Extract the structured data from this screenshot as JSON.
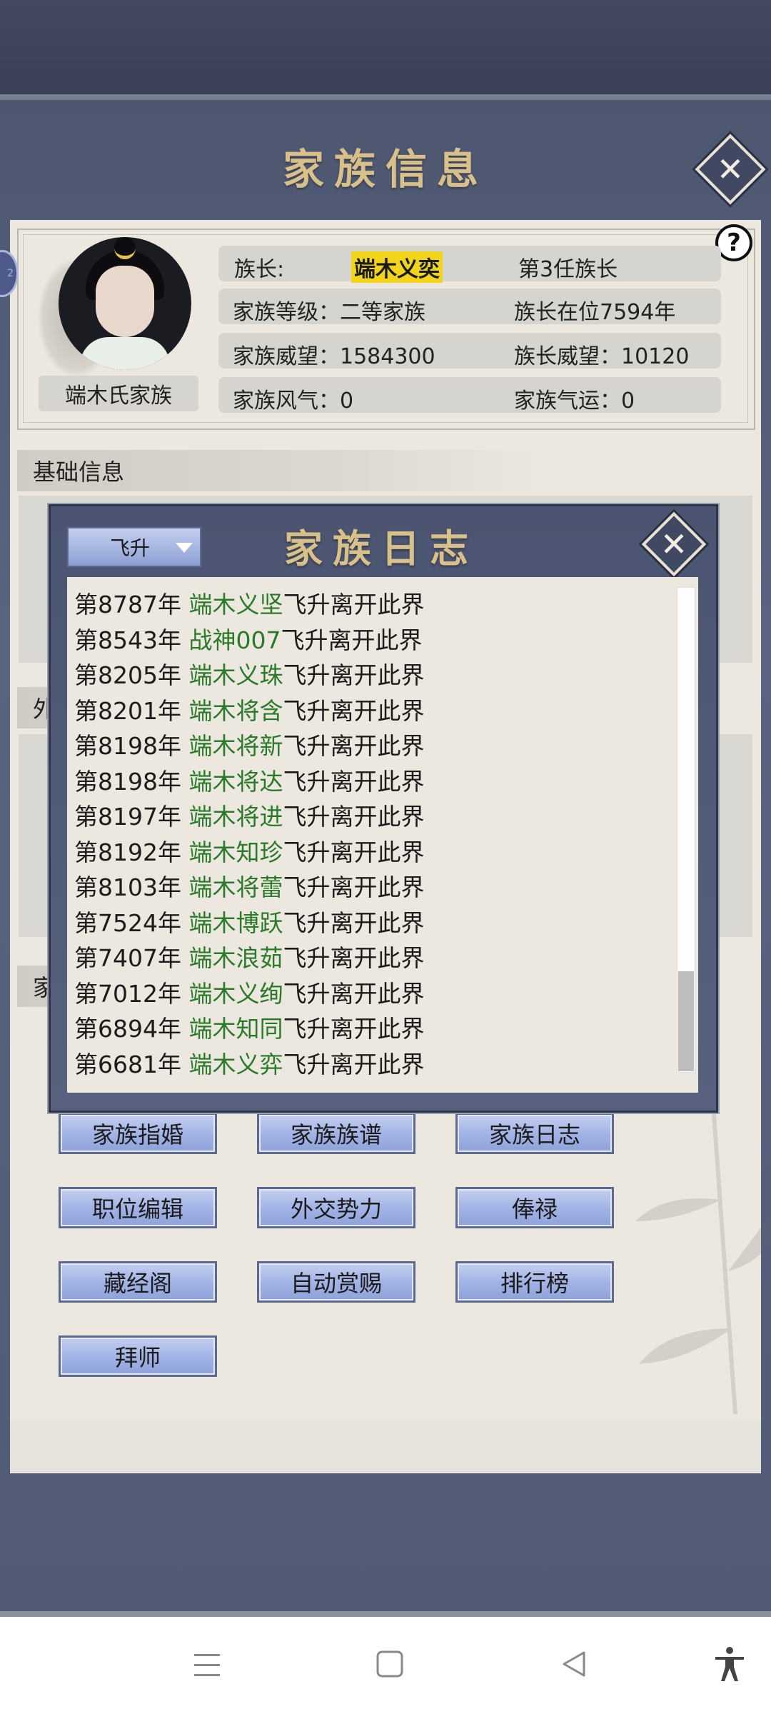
{
  "window_title": "家族信息",
  "help_glyph": "?",
  "edge_badge": "2",
  "profile": {
    "family_name": "端木氏家族",
    "leader_label": "族长:",
    "leader_name": "端木义奕",
    "leader_term": "第3任族长",
    "level": "家族等级：二等家族",
    "tenure": "族长在位7594年",
    "prestige": "家族威望：1584300",
    "leader_prestige": "族长威望：10120",
    "atmosphere": "家族风气：0",
    "fortune": "家族气运：0"
  },
  "sections": {
    "basic": "基础信息",
    "foreign_partial": "外",
    "family_partial": "家"
  },
  "log_dialog": {
    "title": "家族日志",
    "filter_value": "飞升",
    "entries": [
      {
        "year": "第8787年",
        "name": "端木义坚",
        "event": "飞升离开此界"
      },
      {
        "year": "第8543年",
        "name": "战神007",
        "event": "飞升离开此界"
      },
      {
        "year": "第8205年",
        "name": "端木义珠",
        "event": "飞升离开此界"
      },
      {
        "year": "第8201年",
        "name": "端木将含",
        "event": "飞升离开此界"
      },
      {
        "year": "第8198年",
        "name": "端木将新",
        "event": "飞升离开此界"
      },
      {
        "year": "第8198年",
        "name": "端木将达",
        "event": "飞升离开此界"
      },
      {
        "year": "第8197年",
        "name": "端木将进",
        "event": "飞升离开此界"
      },
      {
        "year": "第8192年",
        "name": "端木知珍",
        "event": "飞升离开此界"
      },
      {
        "year": "第8103年",
        "name": "端木将蕾",
        "event": "飞升离开此界"
      },
      {
        "year": "第7524年",
        "name": "端木博跃",
        "event": "飞升离开此界"
      },
      {
        "year": "第7407年",
        "name": "端木浪茹",
        "event": "飞升离开此界"
      },
      {
        "year": "第7012年",
        "name": "端木义绚",
        "event": "飞升离开此界"
      },
      {
        "year": "第6894年",
        "name": "端木知同",
        "event": "飞升离开此界"
      },
      {
        "year": "第6681年",
        "name": "端木义弈",
        "event": "飞升离开此界"
      }
    ]
  },
  "actions": {
    "marriage": "家族指婚",
    "genealogy": "家族族谱",
    "log": "家族日志",
    "positions": "职位编辑",
    "diplomacy": "外交势力",
    "salary": "俸禄",
    "library": "藏经阁",
    "auto_reward": "自动赏赐",
    "ranking": "排行榜",
    "apprentice": "拜师"
  },
  "icons": {
    "close": "close-icon",
    "menu": "menu-icon",
    "home": "home-icon",
    "back": "back-icon",
    "accessibility": "accessibility-icon"
  }
}
